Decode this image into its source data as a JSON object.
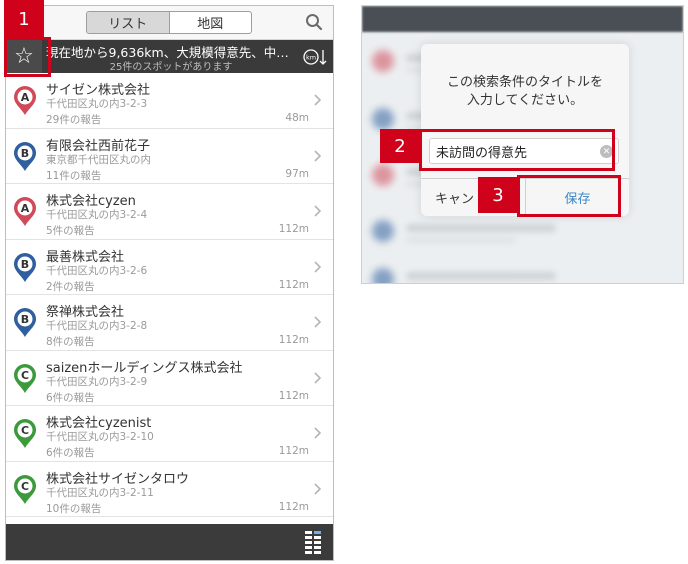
{
  "left_screen": {
    "tabs": [
      {
        "label": "リスト",
        "active": true
      },
      {
        "label": "地図",
        "active": false
      }
    ],
    "banner": {
      "star_glyph": "☆",
      "title": "現在地から9,636km、大規模得意先、中…",
      "subtitle": "25件のスポットがあります",
      "sort_icon_label": "km"
    },
    "spots": [
      {
        "rank": "A",
        "name": "サイゼン株式会社",
        "address": "千代田区丸の内3-2-3",
        "reports": "29件の報告",
        "distance": "48m"
      },
      {
        "rank": "B",
        "name": "有限会社西前花子",
        "address": "東京都千代田区丸の内",
        "reports": "11件の報告",
        "distance": "97m"
      },
      {
        "rank": "A",
        "name": "株式会社cyzen",
        "address": "千代田区丸の内3-2-4",
        "reports": "5件の報告",
        "distance": "112m"
      },
      {
        "rank": "B",
        "name": "最善株式会社",
        "address": "千代田区丸の内3-2-6",
        "reports": "2件の報告",
        "distance": "112m"
      },
      {
        "rank": "B",
        "name": "祭禅株式会社",
        "address": "千代田区丸の内3-2-8",
        "reports": "8件の報告",
        "distance": "112m"
      },
      {
        "rank": "C",
        "name": "saizenホールディングス株式会社",
        "address": "千代田区丸の内3-2-9",
        "reports": "6件の報告",
        "distance": "112m"
      },
      {
        "rank": "C",
        "name": "株式会社cyzenist",
        "address": "千代田区丸の内3-2-10",
        "reports": "6件の報告",
        "distance": "112m"
      },
      {
        "rank": "C",
        "name": "株式会社サイゼンタロウ",
        "address": "千代田区丸の内3-2-11",
        "reports": "10件の報告",
        "distance": "112m"
      }
    ],
    "pin_colors": {
      "A": "#d04a5a",
      "B": "#2f5f9e",
      "C": "#3c9a3c"
    }
  },
  "right_screen": {
    "dialog": {
      "message_line1": "この検索条件のタイトルを",
      "message_line2": "入力してください。",
      "input_value": "未訪問の得意先",
      "cancel_label": "キャン",
      "save_label": "保存"
    }
  },
  "annotations": {
    "badge_1": "1",
    "badge_2": "2",
    "badge_3": "3"
  },
  "colors": {
    "annotation_red": "#d0021b",
    "save_blue": "#3a86c8",
    "dark_bar": "#3a3a3a"
  }
}
